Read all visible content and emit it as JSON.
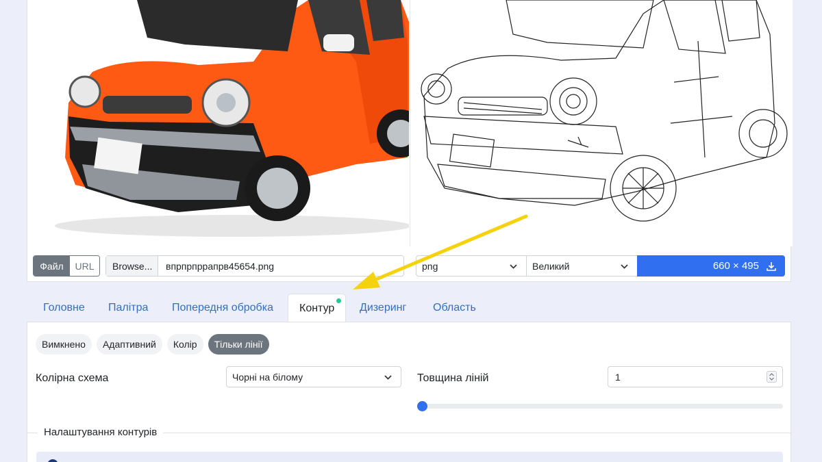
{
  "source": {
    "mode_file": "Файл",
    "mode_url": "URL",
    "browse_label": "Browse...",
    "filename": "впрпрпррапрв45654.png"
  },
  "output": {
    "format": "png",
    "size": "Великий",
    "dimensions": "660 × 495"
  },
  "tabs": [
    {
      "label": "Головне"
    },
    {
      "label": "Палітра"
    },
    {
      "label": "Попередня обробка"
    },
    {
      "label": "Контур"
    },
    {
      "label": "Дизеринг"
    },
    {
      "label": "Область"
    }
  ],
  "contour": {
    "modes": [
      "Вимкнено",
      "Адаптивний",
      "Колір",
      "Тільки лінії"
    ],
    "color_scheme_label": "Колірна схема",
    "color_scheme_value": "Чорні на білому",
    "line_width_label": "Товщина ліній",
    "line_width_value": "1",
    "line_width_level": 1,
    "settings_legend": "Налаштування контурів"
  },
  "colors": {
    "accent": "#2f6ff0",
    "tab_link": "#2f6fc4",
    "pill_active": "#6c757d",
    "badge_dot": "#20c997",
    "arrow": "#f5d20e"
  }
}
